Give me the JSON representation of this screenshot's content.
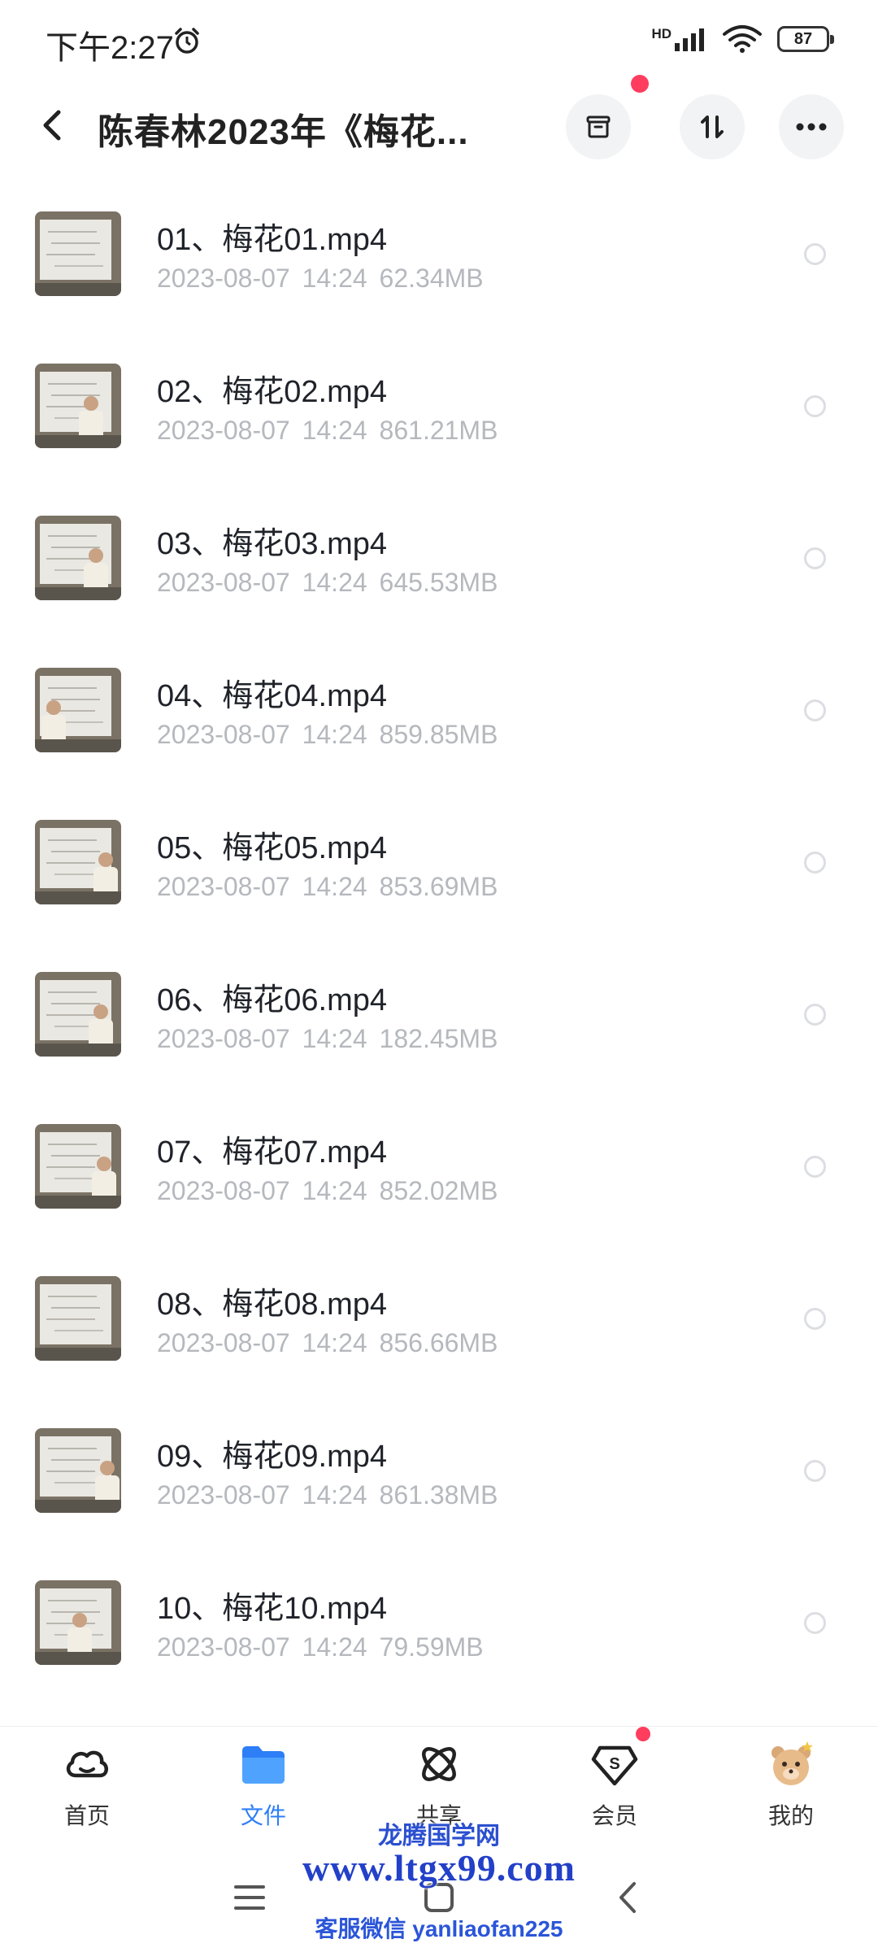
{
  "status_bar": {
    "time": "下午2:27",
    "network_label": "HD",
    "battery": "87"
  },
  "header": {
    "title": "陈春林2023年《梅花..."
  },
  "files": [
    {
      "name": "01、梅花01.mp4",
      "date": "2023-08-07",
      "time": "14:24",
      "size": "62.34MB"
    },
    {
      "name": "02、梅花02.mp4",
      "date": "2023-08-07",
      "time": "14:24",
      "size": "861.21MB"
    },
    {
      "name": "03、梅花03.mp4",
      "date": "2023-08-07",
      "time": "14:24",
      "size": "645.53MB"
    },
    {
      "name": "04、梅花04.mp4",
      "date": "2023-08-07",
      "time": "14:24",
      "size": "859.85MB"
    },
    {
      "name": "05、梅花05.mp4",
      "date": "2023-08-07",
      "time": "14:24",
      "size": "853.69MB"
    },
    {
      "name": "06、梅花06.mp4",
      "date": "2023-08-07",
      "time": "14:24",
      "size": "182.45MB"
    },
    {
      "name": "07、梅花07.mp4",
      "date": "2023-08-07",
      "time": "14:24",
      "size": "852.02MB"
    },
    {
      "name": "08、梅花08.mp4",
      "date": "2023-08-07",
      "time": "14:24",
      "size": "856.66MB"
    },
    {
      "name": "09、梅花09.mp4",
      "date": "2023-08-07",
      "time": "14:24",
      "size": "861.38MB"
    },
    {
      "name": "10、梅花10.mp4",
      "date": "2023-08-07",
      "time": "14:24",
      "size": "79.59MB"
    }
  ],
  "bottom_nav": {
    "items": [
      {
        "label": "首页",
        "icon": "cloud-home-icon"
      },
      {
        "label": "文件",
        "icon": "folder-icon"
      },
      {
        "label": "共享",
        "icon": "share-orbit-icon"
      },
      {
        "label": "会员",
        "icon": "vip-diamond-icon"
      },
      {
        "label": "我的",
        "icon": "bear-avatar-icon"
      }
    ]
  },
  "watermark": {
    "line1": "龙腾国学网",
    "line2": "www.ltgx99.com",
    "line3": "客服微信 yanliaofan225"
  },
  "colors": {
    "accent": "#2d7ef7",
    "badge": "#ff3d5e",
    "meta_text": "#b5b8bd",
    "watermark": "#2340c8"
  }
}
